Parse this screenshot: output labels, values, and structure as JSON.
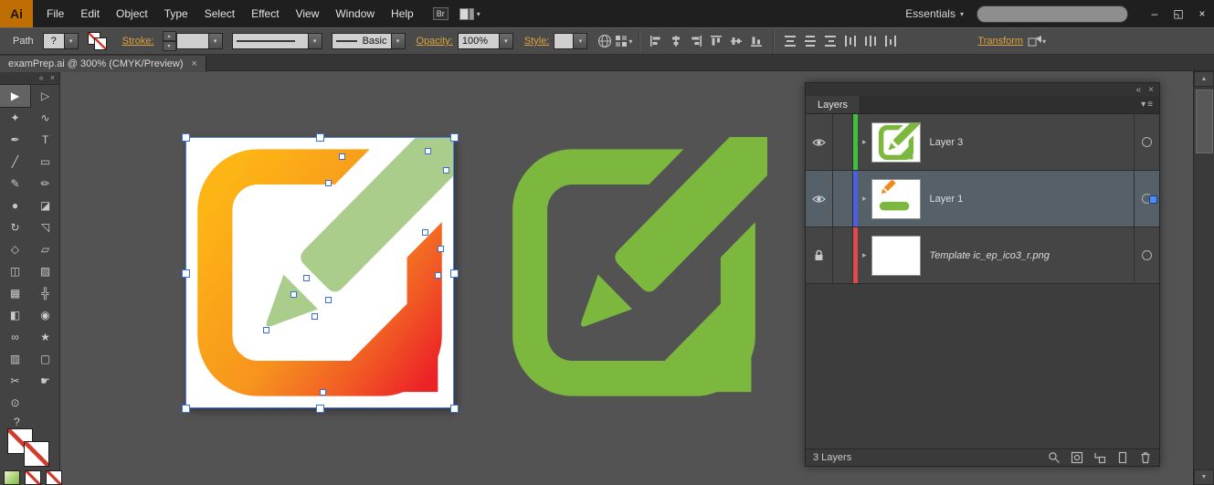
{
  "glyphs": {
    "caret": "▾",
    "up": "▴",
    "collapse": "«",
    "close": "×",
    "expand": "▸",
    "menu": "≡",
    "up_arrow": "▲",
    "down_arrow": "▼",
    "question": "?"
  },
  "colors": {
    "icon_green": "#7CB83E",
    "pencil_light_green": "#AACD8C",
    "gradient_yellow": "#FDB515",
    "gradient_orange": "#F7941E",
    "gradient_red": "#EC2227",
    "selection_blue": "#4A7FE0",
    "layer3_strip": "#3FC13C",
    "layer1_strip": "#4C5FE2",
    "template_strip": "#E04A4A"
  },
  "menubar": {
    "logo": "Ai",
    "items": [
      "File",
      "Edit",
      "Object",
      "Type",
      "Select",
      "Effect",
      "View",
      "Window",
      "Help"
    ],
    "bridge_label": "Br",
    "workspace": "Essentials",
    "search_placeholder": "",
    "minimize": "–",
    "restore": "◱",
    "close": "×"
  },
  "control_bar": {
    "selection_type": "Path",
    "help_button": "?",
    "stroke_label": "Stroke:",
    "brush_name": "Basic",
    "opacity_label": "Opacity:",
    "opacity_value": "100%",
    "style_label": "Style:",
    "transform_label": "Transform"
  },
  "document": {
    "tab_title": "examPrep.ai @ 300% (CMYK/Preview)"
  },
  "tools": [
    {
      "name": "selection-tool",
      "glyph": "▶"
    },
    {
      "name": "direct-selection-tool",
      "glyph": "▷"
    },
    {
      "name": "magic-wand-tool",
      "glyph": "✦"
    },
    {
      "name": "lasso-tool",
      "glyph": "∿"
    },
    {
      "name": "pen-tool",
      "glyph": "✒"
    },
    {
      "name": "type-tool",
      "glyph": "T"
    },
    {
      "name": "line-segment-tool",
      "glyph": "╱"
    },
    {
      "name": "rectangle-tool",
      "glyph": "▭"
    },
    {
      "name": "paintbrush-tool",
      "glyph": "✎"
    },
    {
      "name": "pencil-tool",
      "glyph": "✏"
    },
    {
      "name": "blob-brush-tool",
      "glyph": "●"
    },
    {
      "name": "eraser-tool",
      "glyph": "◪"
    },
    {
      "name": "rotate-tool",
      "glyph": "↻"
    },
    {
      "name": "scale-tool",
      "glyph": "◹"
    },
    {
      "name": "width-tool",
      "glyph": "◇"
    },
    {
      "name": "free-transform-tool",
      "glyph": "▱"
    },
    {
      "name": "shape-builder-tool",
      "glyph": "◫"
    },
    {
      "name": "live-paint-bucket-tool",
      "glyph": "▨"
    },
    {
      "name": "perspective-grid-tool",
      "glyph": "▦"
    },
    {
      "name": "mesh-tool",
      "glyph": "╬"
    },
    {
      "name": "gradient-tool",
      "glyph": "◧"
    },
    {
      "name": "eyedropper-tool",
      "glyph": "◉"
    },
    {
      "name": "blend-tool",
      "glyph": "∞"
    },
    {
      "name": "symbol-sprayer-tool",
      "glyph": "★"
    },
    {
      "name": "column-graph-tool",
      "glyph": "▥"
    },
    {
      "name": "artboard-tool",
      "glyph": "▢"
    },
    {
      "name": "slice-tool",
      "glyph": "✂"
    },
    {
      "name": "hand-tool",
      "glyph": "☛"
    },
    {
      "name": "zoom-tool",
      "glyph": "⊙"
    }
  ],
  "layers": {
    "tab": "Layers",
    "rows": [
      {
        "name": "Layer 3",
        "strip_css": "background:#3FC13C",
        "selected": false,
        "visible": true,
        "locked": false
      },
      {
        "name": "Layer 1",
        "strip_css": "background:#4C5FE2",
        "selected": true,
        "visible": true,
        "locked": false
      },
      {
        "name": "Template ic_ep_ico3_r.png",
        "strip_css": "background:#E04A4A",
        "selected": false,
        "visible": false,
        "locked": true
      }
    ],
    "status": "3 Layers"
  }
}
